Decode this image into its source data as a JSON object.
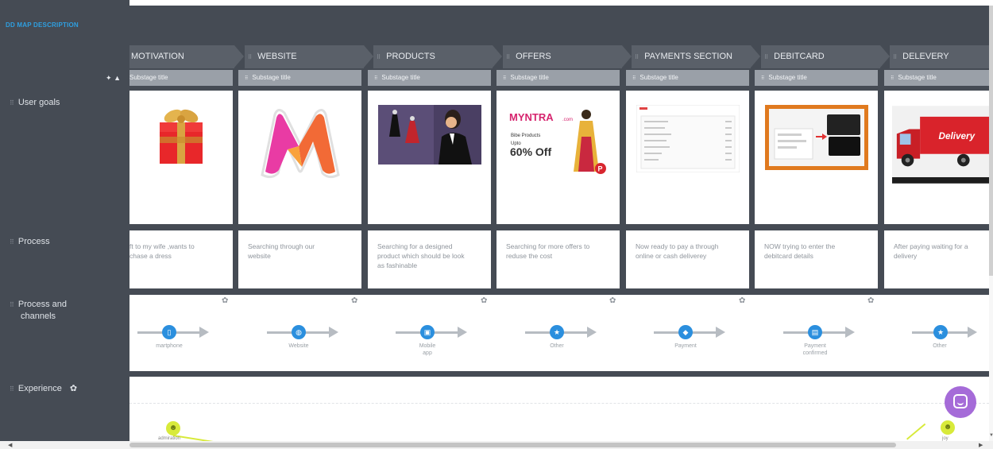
{
  "header": {
    "add_description": "DD MAP DESCRIPTION"
  },
  "rows": {
    "user_goals": "User goals",
    "process": "Process",
    "process_channels_1": "Process and",
    "process_channels_2": "channels",
    "experience": "Experience"
  },
  "stages": [
    {
      "title": "MOTIVATION",
      "substage": "Substage title",
      "text": [
        "ft to my wife ,wants to",
        "chase a dress"
      ],
      "channel": "martphone",
      "channel_icon": "smartphone-icon"
    },
    {
      "title": "WEBSITE",
      "substage": "Substage title",
      "text": [
        "Searching through our",
        "website"
      ],
      "channel": "Website",
      "channel_icon": "globe-icon"
    },
    {
      "title": "PRODUCTS",
      "substage": "Substage title",
      "text": [
        "Searching for a designed",
        "product which should be look",
        "as fashinable"
      ],
      "channel": [
        "Mobile",
        "app"
      ],
      "channel_icon": "mobile-app-icon"
    },
    {
      "title": "OFFERS",
      "substage": "Substage title",
      "text": [
        "Searching for more offers to",
        "reduse the cost"
      ],
      "channel": "Other",
      "channel_icon": "star-icon"
    },
    {
      "title": "PAYMENTS SECTION",
      "substage": "Substage title",
      "text": [
        "Now ready to pay a through",
        "online or cash deliverey"
      ],
      "channel": "Payment",
      "channel_icon": "payment-icon"
    },
    {
      "title": "DEBITCARD",
      "substage": "Substage title",
      "text": [
        "NOW trying to enter the",
        "debitcard details"
      ],
      "channel": [
        "Payment",
        "confirmed"
      ],
      "channel_icon": "card-icon"
    },
    {
      "title": "DELEVERY",
      "substage": "Substage title",
      "text": [
        "After paying waiting for a",
        "delivery"
      ],
      "channel": "Other",
      "channel_icon": "star-icon"
    }
  ],
  "images": {
    "offers": {
      "brand": "MYNTRA",
      "brand_suffix": ".com",
      "line1": "Bibe Products",
      "line2": "Upto",
      "discount": "60% Off"
    },
    "delivery": {
      "word": "Delivery"
    }
  },
  "experience": {
    "left_label": "admiration",
    "right_label": "joy"
  },
  "colors": {
    "dark": "#454b54",
    "stage": "#5a6069",
    "accent": "#2b8fde",
    "smile": "#d8ea3a",
    "chat": "#a56bd8"
  }
}
